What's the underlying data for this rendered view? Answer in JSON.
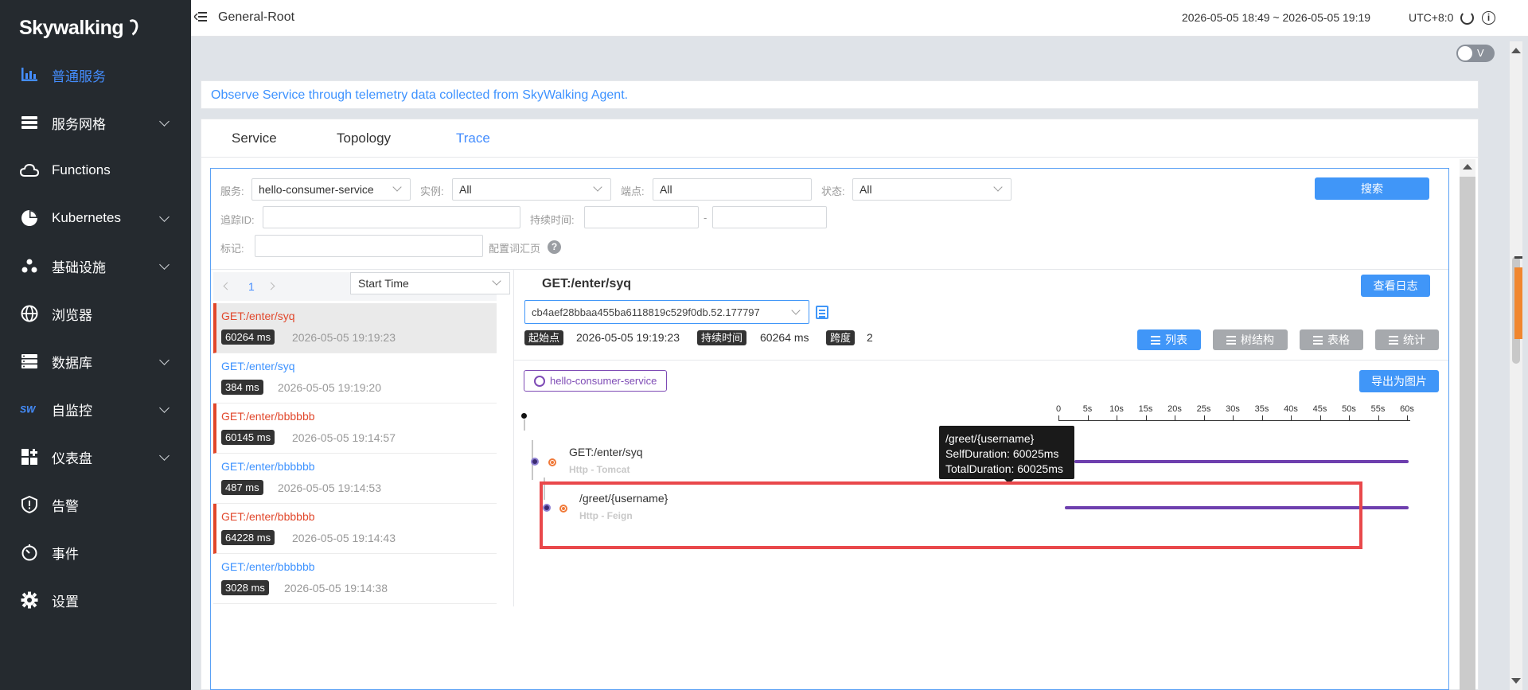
{
  "brand": {
    "logo_text": "Skywalking"
  },
  "sidebar": {
    "items": [
      {
        "label": "普通服务",
        "icon": "bar-chart-icon",
        "active": true,
        "has_children": false
      },
      {
        "label": "服务网格",
        "icon": "layers-icon",
        "active": false,
        "has_children": true
      },
      {
        "label": "Functions",
        "icon": "cloud-icon",
        "active": false,
        "has_children": false
      },
      {
        "label": "Kubernetes",
        "icon": "pie-chart-icon",
        "active": false,
        "has_children": true
      },
      {
        "label": "基础设施",
        "icon": "nodes-icon",
        "active": false,
        "has_children": true
      },
      {
        "label": "浏览器",
        "icon": "globe-icon",
        "active": false,
        "has_children": false
      },
      {
        "label": "数据库",
        "icon": "database-icon",
        "active": false,
        "has_children": true
      },
      {
        "label": "自监控",
        "icon": "sw-logo-icon",
        "active": false,
        "has_children": true
      },
      {
        "label": "仪表盘",
        "icon": "dashboard-grid-icon",
        "active": false,
        "has_children": true
      },
      {
        "label": "告警",
        "icon": "alarm-shield-icon",
        "active": false,
        "has_children": false
      },
      {
        "label": "事件",
        "icon": "timer-icon",
        "active": false,
        "has_children": false
      },
      {
        "label": "设置",
        "icon": "gear-icon",
        "active": false,
        "has_children": false
      }
    ]
  },
  "topbar": {
    "breadcrumb": "General-Root",
    "time_range": "2026-05-05 18:49 ~ 2026-05-05 19:19",
    "timezone": "UTC+8:0"
  },
  "toggle": {
    "label": "V",
    "on": false
  },
  "banner": {
    "text": "Observe Service through telemetry data collected from SkyWalking Agent."
  },
  "tabs": [
    {
      "label": "Service",
      "active": false
    },
    {
      "label": "Topology",
      "active": false
    },
    {
      "label": "Trace",
      "active": true
    }
  ],
  "filters": {
    "service_label": "服务:",
    "service_value": "hello-consumer-service",
    "instance_label": "实例:",
    "instance_value": "All",
    "endpoint_label": "端点:",
    "endpoint_value": "All",
    "status_label": "状态:",
    "status_value": "All",
    "search_button": "搜索",
    "trace_id_label": "追踪ID:",
    "trace_id_value": "",
    "duration_label": "持续时间:",
    "duration_min": "",
    "duration_sep": "-",
    "duration_max": "",
    "tags_label": "标记:",
    "tags_value": "",
    "tags_vocab_link": "配置词汇页"
  },
  "trace_list": {
    "page": "1",
    "sort": "Start Time",
    "items": [
      {
        "endpoint": "GET:/enter/syq",
        "duration": "60264 ms",
        "time": "2026-05-05 19:19:23",
        "error": true,
        "selected": true
      },
      {
        "endpoint": "GET:/enter/syq",
        "duration": "384 ms",
        "time": "2026-05-05 19:19:20",
        "error": false,
        "selected": false
      },
      {
        "endpoint": "GET:/enter/bbbbbb",
        "duration": "60145 ms",
        "time": "2026-05-05 19:14:57",
        "error": true,
        "selected": false
      },
      {
        "endpoint": "GET:/enter/bbbbbb",
        "duration": "487 ms",
        "time": "2026-05-05 19:14:53",
        "error": false,
        "selected": false
      },
      {
        "endpoint": "GET:/enter/bbbbbb",
        "duration": "64228 ms",
        "time": "2026-05-05 19:14:43",
        "error": true,
        "selected": false
      },
      {
        "endpoint": "GET:/enter/bbbbbb",
        "duration": "3028 ms",
        "time": "2026-05-05 19:14:38",
        "error": false,
        "selected": false
      }
    ]
  },
  "trace_detail": {
    "title": "GET:/enter/syq",
    "view_logs_button": "查看日志",
    "trace_id": "cb4aef28bbaa455ba6118819c529f0db.52.177797",
    "start_label": "起始点",
    "start_value": "2026-05-05 19:19:23",
    "duration_label": "持续时间",
    "duration_value": "60264 ms",
    "spans_label": "跨度",
    "spans_value": "2",
    "view_modes": [
      {
        "label": "列表",
        "icon": "list-icon",
        "active": true
      },
      {
        "label": "树结构",
        "icon": "tree-icon",
        "active": false
      },
      {
        "label": "表格",
        "icon": "table-icon",
        "active": false
      },
      {
        "label": "统计",
        "icon": "stats-icon",
        "active": false
      }
    ],
    "service_chip": "hello-consumer-service",
    "export_button": "导出为图片",
    "axis_labels": [
      "0",
      "5s",
      "10s",
      "15s",
      "20s",
      "25s",
      "30s",
      "35s",
      "40s",
      "45s",
      "50s",
      "55s",
      "60s"
    ],
    "spans": [
      {
        "name": "GET:/enter/syq",
        "type": "Http - Tomcat",
        "start_s": 0,
        "end_s": 60.264
      },
      {
        "name": "/greet/{username}",
        "type": "Http - Feign",
        "start_s": 0.2,
        "end_s": 60.225
      }
    ],
    "tooltip": {
      "title": "/greet/{username}",
      "self": "SelfDuration: 60025ms",
      "total": "TotalDuration: 60025ms"
    }
  },
  "colors": {
    "sidebar_bg": "#252a2f",
    "accent": "#448dfe",
    "error": "#e1472b",
    "span_bar": "#6e3fae",
    "highlight": "#e9484b"
  }
}
